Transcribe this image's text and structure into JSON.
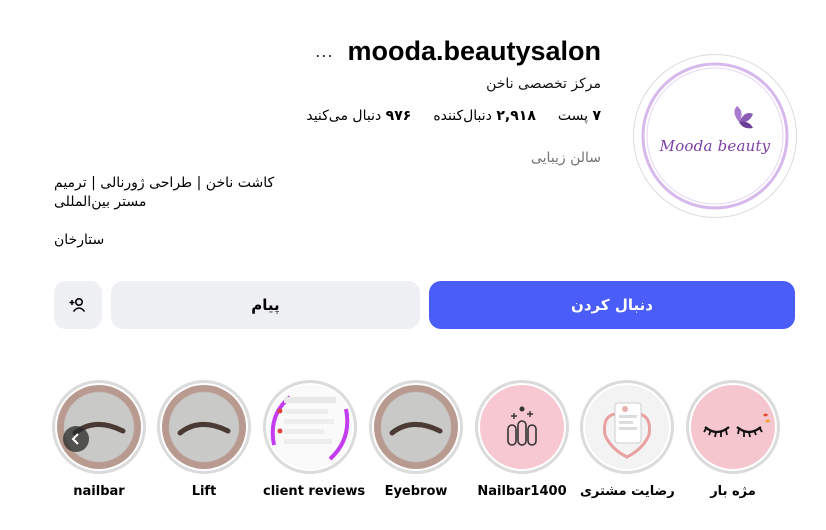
{
  "profile": {
    "username": "mooda.beautysalon",
    "more_icon": "...",
    "category": "مرکز تخصصی ناخن",
    "stats": {
      "posts": {
        "value": "۷",
        "label": "پست"
      },
      "followers": {
        "value": "۲,۹۱۸",
        "label": "دنبال‌کننده"
      },
      "following": {
        "value": "۹۷۶",
        "label": "دنبال می‌کنید"
      }
    },
    "display_name": "سالن زیبایی",
    "bio_line1": "کاشت ناخن | طراحی ژورنالی | ترمیم",
    "bio_line2": "مستر بین‌المللی",
    "location": "ستارخان",
    "avatar_logo_text": "Mooda beauty"
  },
  "actions": {
    "follow_label": "دنبال کردن",
    "message_label": "پیام",
    "suggest_icon": "add-person-icon"
  },
  "highlights": [
    {
      "label": "مژه بار",
      "icon": "eyelash-icon"
    },
    {
      "label": "رضایت مشتری",
      "icon": "phone-review-icon"
    },
    {
      "label": "Nailbar1400",
      "icon": "nails-icon"
    },
    {
      "label": "Eyebrow",
      "icon": "eyebrow-icon"
    },
    {
      "label": "client reviews",
      "icon": "chat-screenshot-icon"
    },
    {
      "label": "Lift",
      "icon": "eyebrow-icon"
    },
    {
      "label": "nailbar",
      "icon": "eyebrow-icon"
    }
  ],
  "colors": {
    "accent": "#4a5df9",
    "secondary_button": "#eff0f3",
    "muted_text": "#737373",
    "logo_purple": "#7b3fa6"
  }
}
